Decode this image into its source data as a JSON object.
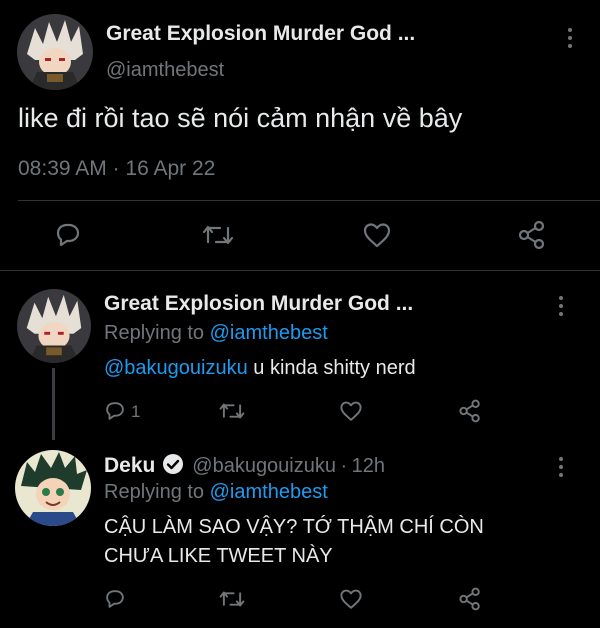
{
  "main_tweet": {
    "display_name": "Great Explosion Murder God ...",
    "handle": "@iamthebest",
    "text": "like đi rồi tao sẽ nói cảm nhận về bây",
    "time": "08:39 AM",
    "separator": "·",
    "date": "16 Apr 22"
  },
  "reply_1": {
    "display_name": "Great Explosion Murder God ...",
    "replying_prefix": "Replying to",
    "replying_handle": "@iamthebest",
    "mention": "@bakugouizuku",
    "text": "u kinda shitty nerd",
    "reply_count": "1"
  },
  "reply_2": {
    "display_name": "Deku",
    "handle": "@bakugouizuku",
    "separator": "·",
    "age": "12h",
    "replying_prefix": "Replying to",
    "replying_handle": "@iamthebest",
    "text_line1": "CẬU LÀM SAO VẬY? TỚ THẬM CHÍ CÒN",
    "text_line2": "CHƯA LIKE TWEET NÀY"
  },
  "colors": {
    "background": "#000000",
    "text": "#e7e9ea",
    "muted": "#71767b",
    "link": "#1d9bf0",
    "verified_badge": "#e7e9ea"
  },
  "icons": [
    "reply-icon",
    "retweet-icon",
    "like-icon",
    "share-icon",
    "more-icon",
    "verified-icon"
  ]
}
